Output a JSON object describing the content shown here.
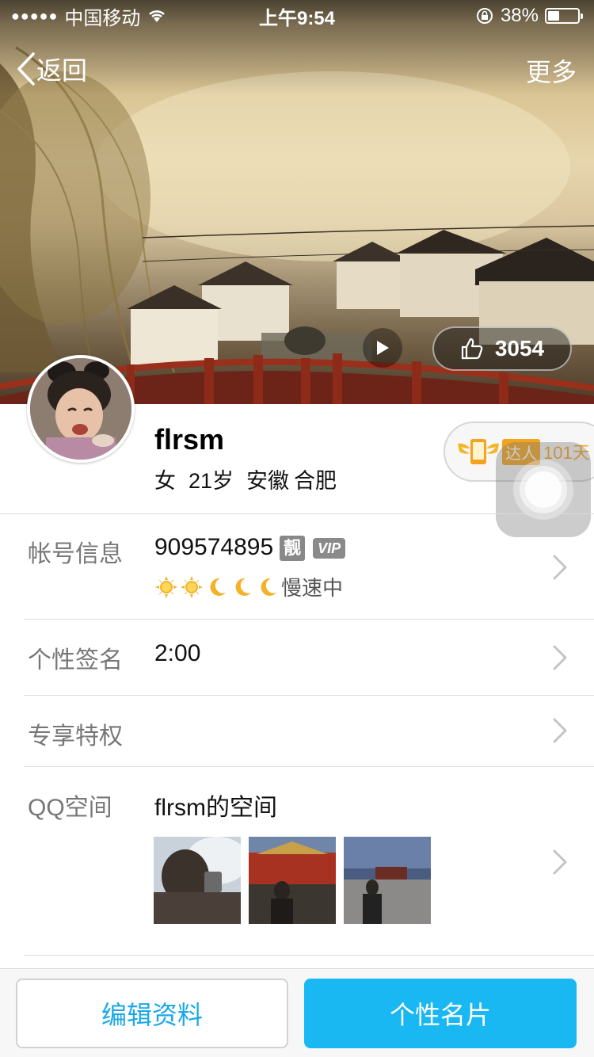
{
  "status_bar": {
    "carrier": "中国移动",
    "time": "上午9:54",
    "battery_percent": "38%",
    "battery_level": 0.38
  },
  "nav": {
    "back_label": "返回",
    "more_label": "更多"
  },
  "cover": {
    "like_count": "3054"
  },
  "profile": {
    "nickname": "flrsm",
    "gender": "女",
    "age": "21岁",
    "province": "安徽",
    "city": "合肥",
    "daren_tag": "达人",
    "daren_days": "101天"
  },
  "rows": {
    "account": {
      "label": "帐号信息",
      "qq_number": "909574895",
      "liang_badge": "靓",
      "vip_badge": "VIP",
      "level_icons": [
        "sun-icon",
        "sun-icon",
        "moon-icon",
        "moon-icon",
        "moon-icon"
      ],
      "speed_text": "慢速中"
    },
    "signature": {
      "label": "个性签名",
      "value": "2:00"
    },
    "privilege": {
      "label": "专享特权"
    },
    "qzone": {
      "label": "QQ空间",
      "value": "flrsm的空间",
      "photos": [
        "photo-1",
        "photo-2",
        "photo-3"
      ]
    }
  },
  "bottom_bar": {
    "edit_label": "编辑资料",
    "card_label": "个性名片"
  },
  "colors": {
    "accent": "#1ab8f2",
    "edit_text": "#1aa8e6",
    "daren": "#f3a31d"
  }
}
